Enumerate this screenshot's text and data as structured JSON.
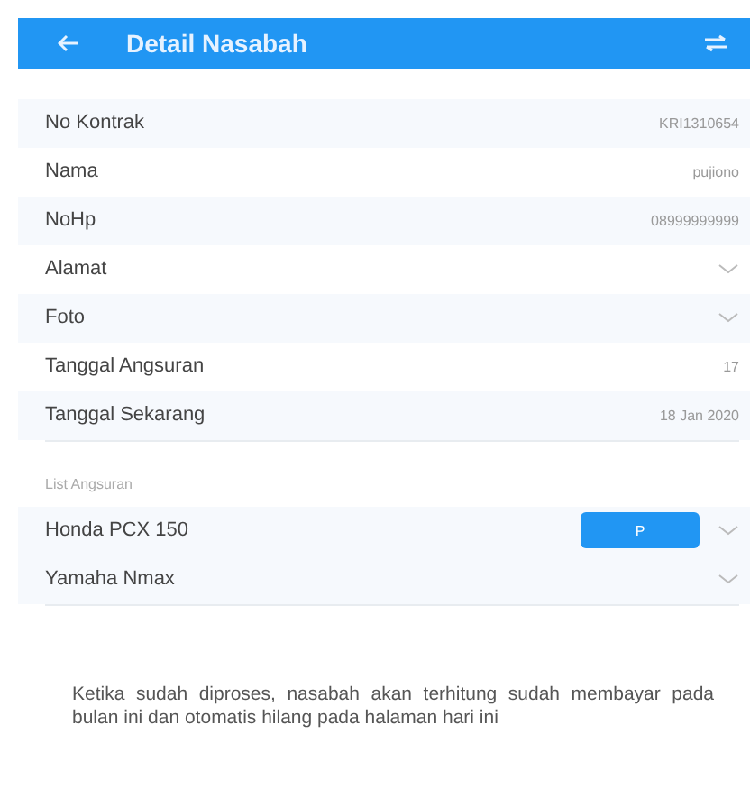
{
  "header": {
    "title": "Detail Nasabah"
  },
  "details": [
    {
      "label": "No Kontrak",
      "kind": "value",
      "value": "KRI1310654"
    },
    {
      "label": "Nama",
      "kind": "value",
      "value": "pujiono"
    },
    {
      "label": "NoHp",
      "kind": "value",
      "value": "08999999999"
    },
    {
      "label": "Alamat",
      "kind": "expand"
    },
    {
      "label": "Foto",
      "kind": "expand"
    },
    {
      "label": "Tanggal Angsuran",
      "kind": "value",
      "value": "17"
    },
    {
      "label": "Tanggal Sekarang",
      "kind": "value",
      "value": "18 Jan 2020"
    }
  ],
  "list_title": "List Angsuran",
  "installments": [
    {
      "name": "Honda PCX 150",
      "button": "P"
    },
    {
      "name": "Yamaha Nmax"
    }
  ],
  "note": "Ketika sudah diproses, nasabah akan terhitung sudah membayar pada bulan ini dan otomatis hilang pada halaman hari ini"
}
